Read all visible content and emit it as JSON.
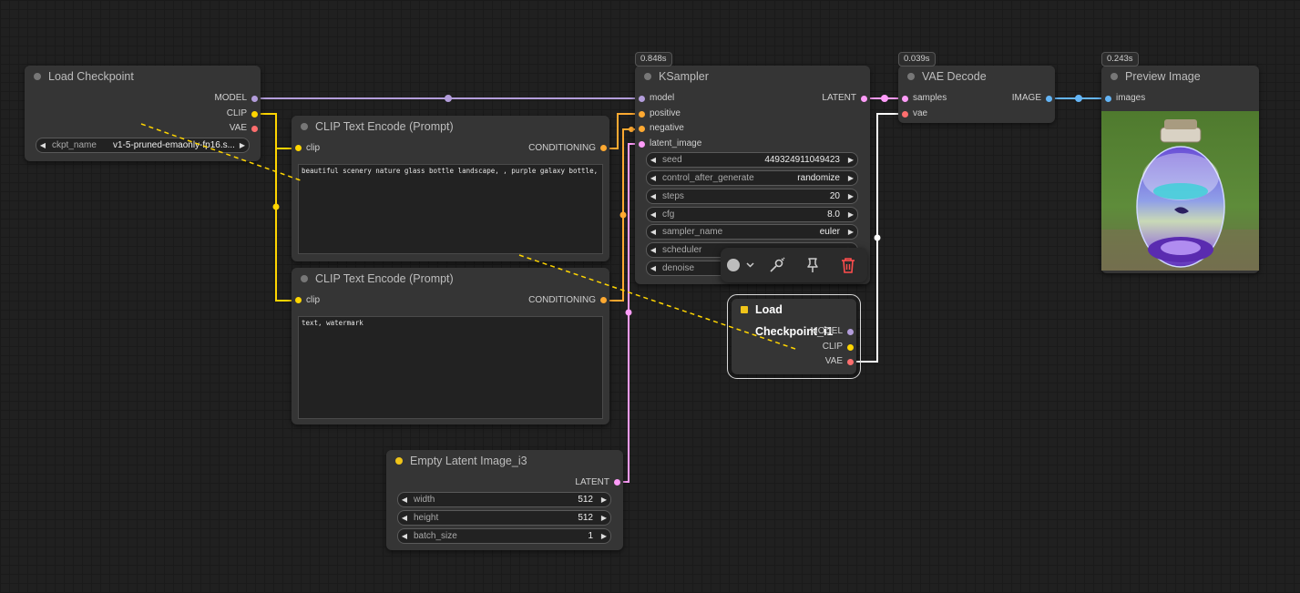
{
  "colors": {
    "model": "#b39ddb",
    "clip": "#ffd500",
    "vae": "#ff6e6e",
    "conditioning": "#ffa931",
    "latent": "#ff9cf9",
    "image": "#64b5f6"
  },
  "nodes": {
    "load_checkpoint": {
      "title": "Load Checkpoint",
      "outputs": [
        "MODEL",
        "CLIP",
        "VAE"
      ],
      "ckpt_label": "ckpt_name",
      "ckpt_value": "v1-5-pruned-emaonly-fp16.s..."
    },
    "clip_pos": {
      "title": "CLIP Text Encode (Prompt)",
      "input": "clip",
      "output": "CONDITIONING",
      "text": "beautiful scenery nature glass bottle landscape, , purple galaxy bottle,"
    },
    "clip_neg": {
      "title": "CLIP Text Encode (Prompt)",
      "input": "clip",
      "output": "CONDITIONING",
      "text": "text, watermark"
    },
    "ksampler": {
      "title": "KSampler",
      "timing": "0.848s",
      "inputs": [
        "model",
        "positive",
        "negative",
        "latent_image"
      ],
      "output": "LATENT",
      "widgets": [
        {
          "name": "seed",
          "value": "449324911049423"
        },
        {
          "name": "control_after_generate",
          "value": "randomize"
        },
        {
          "name": "steps",
          "value": "20"
        },
        {
          "name": "cfg",
          "value": "8.0"
        },
        {
          "name": "sampler_name",
          "value": "euler"
        },
        {
          "name": "scheduler",
          "value": ""
        },
        {
          "name": "denoise",
          "value": ""
        }
      ]
    },
    "vae_decode": {
      "title": "VAE Decode",
      "timing": "0.039s",
      "inputs": [
        "samples",
        "vae"
      ],
      "output": "IMAGE"
    },
    "preview": {
      "title": "Preview Image",
      "timing": "0.243s",
      "input": "images"
    },
    "empty_latent": {
      "title": "Empty Latent Image_i3",
      "output": "LATENT",
      "widgets": [
        {
          "name": "width",
          "value": "512"
        },
        {
          "name": "height",
          "value": "512"
        },
        {
          "name": "batch_size",
          "value": "1"
        }
      ]
    },
    "load_checkpoint_i1": {
      "title": "Load Checkpoint_i1",
      "outputs": [
        "MODEL",
        "CLIP",
        "VAE"
      ]
    }
  },
  "toolbar": {
    "icons": [
      "color-circle-icon",
      "chevron-down-icon",
      "bypass-icon",
      "pin-icon",
      "trash-icon"
    ]
  }
}
